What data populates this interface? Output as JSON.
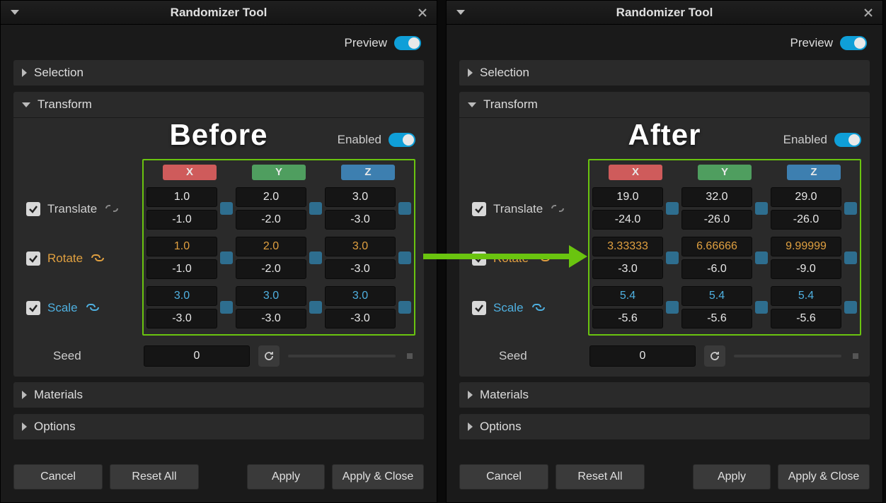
{
  "window_title": "Randomizer Tool",
  "preview_label": "Preview",
  "enabled_label": "Enabled",
  "sections": {
    "selection": "Selection",
    "transform": "Transform",
    "materials": "Materials",
    "options": "Options"
  },
  "axes": {
    "x": "X",
    "y": "Y",
    "z": "Z"
  },
  "rows": {
    "translate": "Translate",
    "rotate": "Rotate",
    "scale": "Scale"
  },
  "seed_label": "Seed",
  "buttons": {
    "cancel": "Cancel",
    "reset": "Reset All",
    "apply": "Apply",
    "apply_close": "Apply & Close"
  },
  "overlay": {
    "before": "Before",
    "after": "After"
  },
  "panels": [
    {
      "id": "before",
      "overlay": "Before",
      "seed": "0",
      "translate": {
        "x": {
          "hi": "1.0",
          "lo": "-1.0"
        },
        "y": {
          "hi": "2.0",
          "lo": "-2.0"
        },
        "z": {
          "hi": "3.0",
          "lo": "-3.0"
        },
        "linked": false
      },
      "rotate": {
        "x": {
          "hi": "1.0",
          "lo": "-1.0"
        },
        "y": {
          "hi": "2.0",
          "lo": "-2.0"
        },
        "z": {
          "hi": "3.0",
          "lo": "-3.0"
        },
        "linked": true
      },
      "scale": {
        "x": {
          "hi": "3.0",
          "lo": "-3.0"
        },
        "y": {
          "hi": "3.0",
          "lo": "-3.0"
        },
        "z": {
          "hi": "3.0",
          "lo": "-3.0"
        },
        "linked": true
      }
    },
    {
      "id": "after",
      "overlay": "After",
      "seed": "0",
      "translate": {
        "x": {
          "hi": "19.0",
          "lo": "-24.0"
        },
        "y": {
          "hi": "32.0",
          "lo": "-26.0"
        },
        "z": {
          "hi": "29.0",
          "lo": "-26.0"
        },
        "linked": false
      },
      "rotate": {
        "x": {
          "hi": "3.33333",
          "lo": "-3.0"
        },
        "y": {
          "hi": "6.66666",
          "lo": "-6.0"
        },
        "z": {
          "hi": "9.99999",
          "lo": "-9.0"
        },
        "linked": true
      },
      "scale": {
        "x": {
          "hi": "5.4",
          "lo": "-5.6"
        },
        "y": {
          "hi": "5.4",
          "lo": "-5.6"
        },
        "z": {
          "hi": "5.4",
          "lo": "-5.6"
        },
        "linked": true
      }
    }
  ]
}
